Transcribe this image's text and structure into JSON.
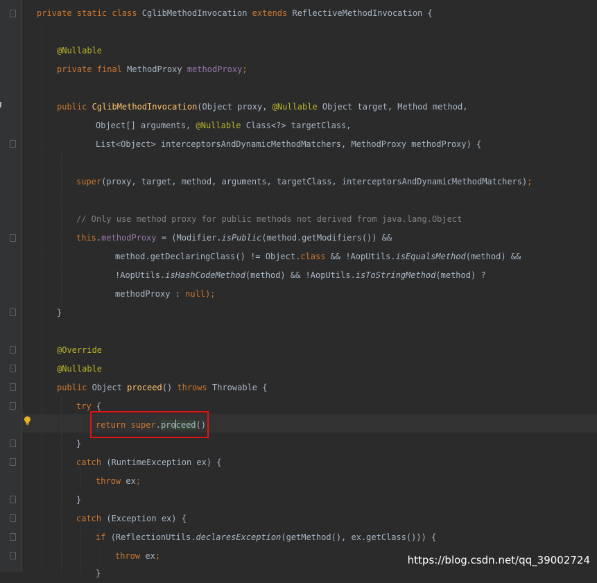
{
  "code": {
    "l1": {
      "kw": "private static class ",
      "cls": "CglibMethodInvocation ",
      "kw2": "extends ",
      "rest": "ReflectiveMethodInvocation {"
    },
    "l2": {
      "ann": "@Nullable"
    },
    "l3": {
      "kw": "private final ",
      "type": "MethodProxy ",
      "fld": "methodProxy",
      "semi": ";"
    },
    "l4": {
      "kw": "public ",
      "mth": "CglibMethodInvocation",
      "p1": "(Object proxy, ",
      "ann": "@Nullable",
      "p2": " Object target, Method method,"
    },
    "l5": {
      "p1": "Object[] arguments, ",
      "ann": "@Nullable",
      "p2": " Class<?> targetClass,"
    },
    "l6": {
      "text": "List<Object> interceptorsAndDynamicMethodMatchers, MethodProxy methodProxy) {"
    },
    "l7": {
      "kw": "super",
      "text": "(proxy, target, method, arguments, targetClass, interceptorsAndDynamicMethodMatchers)",
      "semi": ";"
    },
    "l8": {
      "cmt": "// Only use method proxy for public methods not derived from java.lang.Object"
    },
    "l9": {
      "kw": "this",
      "dot": ".",
      "fld": "methodProxy",
      "p1": " = (Modifier.",
      "sm": "isPublic",
      "p2": "(method.getModifiers()) &&"
    },
    "l10": {
      "p1": "method.getDeclaringClass() != Object.",
      "kw": "class",
      "p2": " && !AopUtils.",
      "sm": "isEqualsMethod",
      "p3": "(method) &&"
    },
    "l11": {
      "p1": "!AopUtils.",
      "sm": "isHashCodeMethod",
      "p2": "(method) && !AopUtils.",
      "sm2": "isToStringMethod",
      "p3": "(method) ?"
    },
    "l12": {
      "p1": "methodProxy : ",
      "kw": "null",
      "semi": ");"
    },
    "l13": {
      "text": "}"
    },
    "l14": {
      "ann": "@Override"
    },
    "l15": {
      "ann": "@Nullable"
    },
    "l16": {
      "kw": "public ",
      "type": "Object ",
      "mth": "proceed",
      "p1": "() ",
      "kw2": "throws ",
      "p2": "Throwable {"
    },
    "l17": {
      "kw": "try ",
      "text": "{"
    },
    "l18": {
      "kw": "return super",
      "dot": ".",
      "w1": "pro",
      "w2": "ceed",
      "p1": "()",
      "semi": ";"
    },
    "l19": {
      "text": "}"
    },
    "l20": {
      "kw": "catch ",
      "text": "(RuntimeException ex) {"
    },
    "l21": {
      "kw": "throw ",
      "text": "ex",
      "semi": ";"
    },
    "l22": {
      "text": "}"
    },
    "l23": {
      "kw": "catch ",
      "text": "(Exception ex) {"
    },
    "l24": {
      "kw": "if ",
      "p1": "(ReflectionUtils.",
      "sm": "declaresException",
      "p2": "(getMethod(), ex.getClass())) {"
    },
    "l25": {
      "kw": "throw ",
      "text": "ex",
      "semi": ";"
    },
    "l26": {
      "text": "}"
    }
  },
  "watermark": "https://blog.csdn.net/qq_39002724",
  "colors": {
    "background": "#2b2b2b",
    "keyword": "#cc7832",
    "annotation": "#bbb529",
    "field": "#9876aa",
    "method": "#ffc66d",
    "comment": "#808080",
    "text": "#a9b7c6",
    "highlight_box": "#e01414"
  },
  "icons": [
    "fold-marker-icon",
    "lightbulb-icon"
  ]
}
